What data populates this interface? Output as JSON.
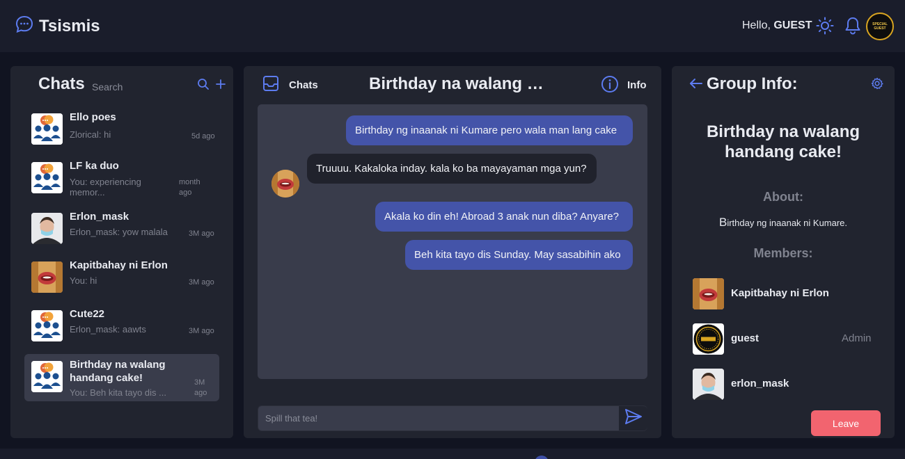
{
  "app": {
    "title": "Tsismis"
  },
  "header": {
    "greeting": "Hello,",
    "username": "GUEST",
    "badge_line1": "SPECIAL",
    "badge_line2": "GUEST"
  },
  "sidebar": {
    "title": "Chats",
    "search_placeholder": "Search",
    "chats": [
      {
        "name": "Ello poes",
        "preview": "Zlorical: hi",
        "time": "5d ago",
        "avatar": "group"
      },
      {
        "name": "LF ka duo",
        "preview": "You: experiencing memor...",
        "time": "month ago",
        "avatar": "group"
      },
      {
        "name": "Erlon_mask",
        "preview": "Erlon_mask: yow malala",
        "time": "3M ago",
        "avatar": "man"
      },
      {
        "name": "Kapitbahay ni Erlon",
        "preview": "You: hi",
        "time": "3M ago",
        "avatar": "lips"
      },
      {
        "name": "Cute22",
        "preview": "Erlon_mask: aawts",
        "time": "3M ago",
        "avatar": "group"
      },
      {
        "name": "Birthday na walang handang cake!",
        "preview": "You: Beh kita tayo dis ...",
        "time": "3M ago",
        "avatar": "group",
        "active": true
      }
    ]
  },
  "conversation": {
    "back_label": "Chats",
    "title": "Birthday na walang ha...",
    "info_label": "Info",
    "messages": [
      {
        "text": "Birthday ng inaanak ni Kumare pero wala man lang cake",
        "direction": "out"
      },
      {
        "text": "Truuuu. Kakaloka inday. kala ko ba mayayaman mga yun?",
        "direction": "in"
      },
      {
        "text": "Akala ko din eh! Abroad 3 anak nun diba? Anyare?",
        "direction": "out"
      },
      {
        "text": "Beh kita tayo dis Sunday. May sasabihin ako",
        "direction": "out"
      }
    ],
    "composer_placeholder": "Spill that tea!"
  },
  "group_info": {
    "title": "Group Info:",
    "name": "Birthday na walang handang cake!",
    "about_heading": "About:",
    "about": "Birthday ng inaanak ni Kumare.",
    "members_heading": "Members:",
    "members": [
      {
        "name": "Kapitbahay ni Erlon",
        "role": "",
        "avatar": "lips"
      },
      {
        "name": "guest",
        "role": "Admin",
        "avatar": "badge"
      },
      {
        "name": "erlon_mask",
        "role": "",
        "avatar": "man"
      }
    ],
    "leave_label": "Leave"
  },
  "colors": {
    "accent": "#4454a9",
    "danger": "#f2646f",
    "panel": "#21242f",
    "background": "#111421"
  }
}
